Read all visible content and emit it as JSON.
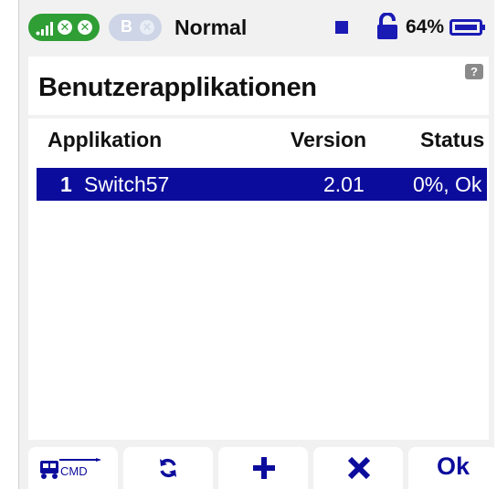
{
  "status_bar": {
    "receiver_a_badge": "signal-bars-icon, close-icon, close-icon",
    "receiver_b_label": "B",
    "mode": "Normal",
    "battery_percent": "64%",
    "colors": {
      "green": "#2e9e35",
      "blue": "#0c0c9c",
      "gray_pill": "#cdd5e6"
    }
  },
  "page": {
    "title": "Benutzerapplikationen",
    "help_icon": "?"
  },
  "table": {
    "columns": [
      "Applikation",
      "Version",
      "Status"
    ],
    "rows": [
      {
        "index": "1",
        "name": "Switch57",
        "version": "2.01",
        "status": "0%, Ok",
        "selected": true
      }
    ]
  },
  "buttons": {
    "cmd": "CMD",
    "refresh_icon": "refresh-icon",
    "add_icon": "plus-icon",
    "delete_icon": "close-icon",
    "ok": "Ok"
  }
}
